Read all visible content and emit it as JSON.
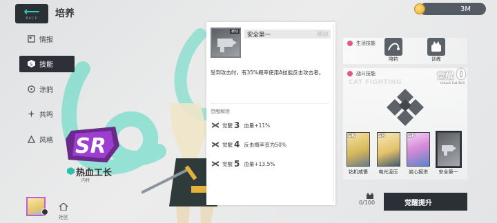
{
  "header": {
    "back_sub": "BACK",
    "title": "培养",
    "currency_value": "3M"
  },
  "nav": {
    "items": [
      {
        "label": "情报",
        "icon": "info-icon"
      },
      {
        "label": "技能",
        "icon": "skill-icon",
        "active": true
      },
      {
        "label": "涂鸦",
        "icon": "graffiti-icon"
      },
      {
        "label": "共鸣",
        "icon": "resonance-icon"
      },
      {
        "label": "风格",
        "icon": "style-icon"
      }
    ]
  },
  "character": {
    "rarity": "SR",
    "name": "热血工长",
    "role": "内特"
  },
  "bottom_left": {
    "community_label": "社区"
  },
  "detail_card": {
    "tag": "被动",
    "name": "安全第一",
    "type": "被动",
    "description": "受到攻击时，有35%概率使用A技能反击攻击者。",
    "unlock_title": "觉醒解锁",
    "unlocks": [
      {
        "awaken": "觉醒",
        "level": "3",
        "effect": "血量+11%"
      },
      {
        "awaken": "觉醒",
        "level": "4",
        "effect": "反击概率变为50%"
      },
      {
        "awaken": "觉醒",
        "level": "5",
        "effect": "血量+13.5%"
      }
    ]
  },
  "right_panel": {
    "life_skill_title": "生活技能",
    "life_skills": [
      {
        "label": "陪钓",
        "icon": "fishing-icon"
      },
      {
        "label": "训练",
        "icon": "training-icon"
      }
    ],
    "battle_skill_title": "战斗技能",
    "cat_fighting": "CAT FIGHTING",
    "awaken_label": "觉醒",
    "awaken_level": "0",
    "awaken_sub": "Unlock Cat Skill",
    "skill_cards": [
      {
        "label": "钻机威慑",
        "tier": "SR"
      },
      {
        "label": "电光凌压",
        "tier": "SR"
      },
      {
        "label": "岩心掘进",
        "tier": "SP"
      },
      {
        "label": "安全第一",
        "tier": ""
      }
    ],
    "progress": "0/100",
    "awaken_button": "觉醒提升"
  },
  "colors": {
    "accent": "#2fd0c0",
    "dark": "#2b2f36",
    "pink": "#e4568c",
    "purple": "#c35bdb"
  }
}
